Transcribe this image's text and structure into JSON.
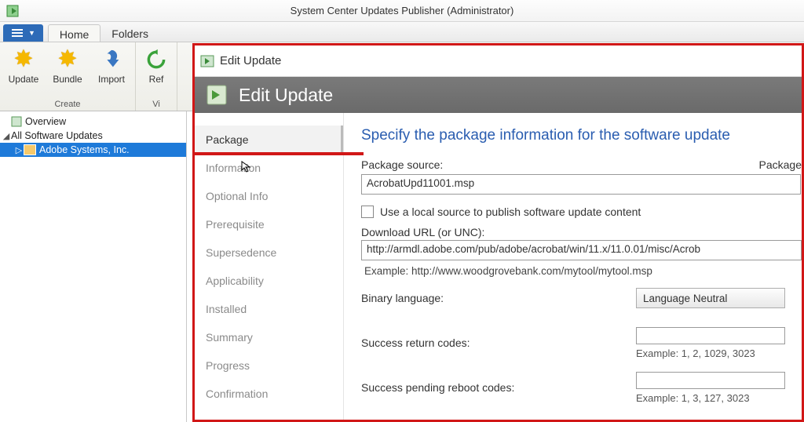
{
  "titlebar": {
    "title": "System Center Updates Publisher (Administrator)"
  },
  "ribbon": {
    "tabs": {
      "home": "Home",
      "folders": "Folders"
    },
    "buttons": {
      "update": "Update",
      "bundle": "Bundle",
      "import": "Import",
      "refresh": "Ref"
    },
    "group_create": "Create",
    "group_view": "Vi"
  },
  "tree": {
    "overview": "Overview",
    "all_updates": "All Software Updates",
    "adobe": "Adobe Systems, Inc."
  },
  "dialog": {
    "window_title": "Edit Update",
    "header": "Edit Update",
    "nav": {
      "package": "Package",
      "information": "Information",
      "optional": "Optional Info",
      "prerequisite": "Prerequisite",
      "supersedence": "Supersedence",
      "applicability": "Applicability",
      "installed": "Installed",
      "summary": "Summary",
      "progress": "Progress",
      "confirmation": "Confirmation"
    },
    "form": {
      "heading": "Specify the package information for the software update",
      "pkg_source_label": "Package source:",
      "pkg_right_label": "Package",
      "pkg_source_value": "AcrobatUpd11001.msp",
      "local_source_label": "Use a local source to publish software update content",
      "download_url_label": "Download URL (or UNC):",
      "download_url_value": "http://armdl.adobe.com/pub/adobe/acrobat/win/11.x/11.0.01/misc/Acrob",
      "download_example": "Example: http://www.woodgrovebank.com/mytool/mytool.msp",
      "binary_lang_label": "Binary language:",
      "binary_lang_value": "Language Neutral",
      "success_codes_label": "Success return codes:",
      "success_codes_example": "Example: 1, 2, 1029, 3023",
      "pending_codes_label": "Success pending reboot codes:",
      "pending_codes_example": "Example: 1, 3, 127, 3023"
    }
  }
}
